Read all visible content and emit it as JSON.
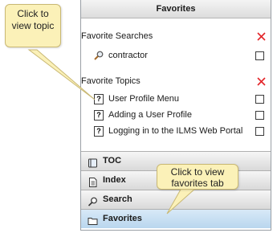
{
  "panel": {
    "title": "Favorites"
  },
  "favorite_searches": {
    "title": "Favorite Searches",
    "items": [
      {
        "label": "contractor",
        "icon": "magnifier-icon"
      }
    ]
  },
  "favorite_topics": {
    "title": "Favorite Topics",
    "items": [
      {
        "label": "User Profile Menu",
        "icon": "help-topic-icon"
      },
      {
        "label": "Adding a User Profile",
        "icon": "help-topic-icon"
      },
      {
        "label": "Logging in to the ILMS Web Portal",
        "icon": "help-topic-icon"
      }
    ]
  },
  "tabs": [
    {
      "label": "TOC",
      "icon": "book-icon"
    },
    {
      "label": "Index",
      "icon": "index-page-icon"
    },
    {
      "label": "Search",
      "icon": "search-icon"
    },
    {
      "label": "Favorites",
      "icon": "folder-icon",
      "active": true
    }
  ],
  "callouts": {
    "topic": "Click to view topic",
    "favorites_tab": "Click to view favorites tab"
  },
  "colors": {
    "remove_x": "#e3262a",
    "callout_bg": "#fbf1b8",
    "active_tab": "#c7def2"
  }
}
